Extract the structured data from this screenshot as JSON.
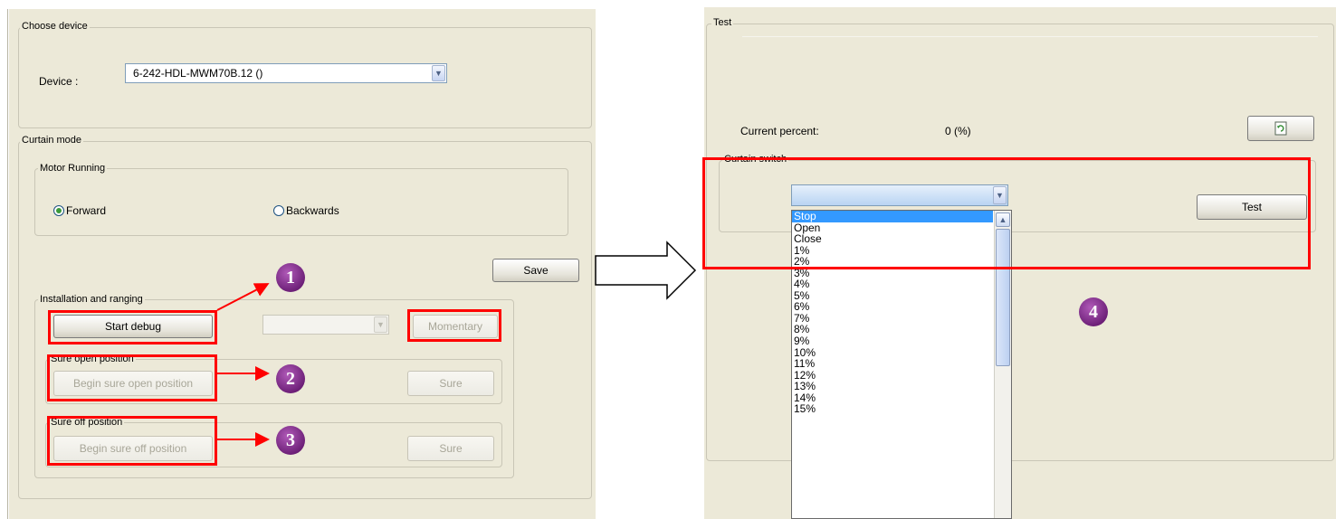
{
  "left_window": {
    "choose_device": {
      "legend": "Choose device",
      "device_label": "Device :",
      "device_value": "6-242-HDL-MWM70B.12 ()"
    },
    "curtain_mode": {
      "legend": "Curtain mode",
      "motor_running": {
        "legend": "Motor Running",
        "forward_label": "Forward",
        "backwards_label": "Backwards",
        "selected": "Forward"
      },
      "save_label": "Save",
      "installation": {
        "legend": "Installation and ranging",
        "start_debug_label": "Start debug",
        "momentary_label": "Momentary"
      },
      "open_position": {
        "legend": "Sure open position",
        "begin_label": "Begin sure open position",
        "sure_label": "Sure"
      },
      "off_position": {
        "legend": "Sure off position",
        "begin_label": "Begin sure off position",
        "sure_label": "Sure"
      }
    }
  },
  "right_window": {
    "test": {
      "legend": "Test",
      "current_percent_label": "Current percent:",
      "current_percent_value": "0 (%)"
    },
    "curtain_switch": {
      "legend": "Curtain switch",
      "test_label": "Test",
      "combo_value": "",
      "options": [
        "Stop",
        "Open",
        "Close",
        "1%",
        "2%",
        "3%",
        "4%",
        "5%",
        "6%",
        "7%",
        "8%",
        "9%",
        "10%",
        "11%",
        "12%",
        "13%",
        "14%",
        "15%"
      ],
      "highlighted": "Stop"
    }
  },
  "annotations": {
    "step1": "1",
    "step2": "2",
    "step3": "3",
    "step4": "4",
    "highlight_color": "#ff0000",
    "badge_color": "#7a2a86"
  }
}
